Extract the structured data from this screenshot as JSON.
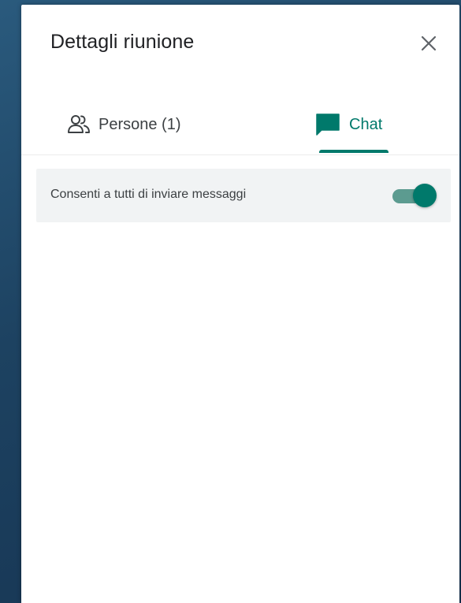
{
  "panel": {
    "title": "Dettagli riunione"
  },
  "tabs": [
    {
      "label": "Persone (1)",
      "icon": "people-icon",
      "active": false
    },
    {
      "label": "Chat",
      "icon": "chat-icon",
      "active": true
    }
  ],
  "chat_settings": {
    "allow_messages_label": "Consenti a tutti di inviare messaggi",
    "allow_messages_enabled": true
  },
  "colors": {
    "accent": "#00796b",
    "toggle_track": "#5c9b90",
    "setting_background": "#f1f3f4",
    "text_primary": "#202124",
    "text_secondary": "#3c4043",
    "backdrop": "#1f4463"
  }
}
